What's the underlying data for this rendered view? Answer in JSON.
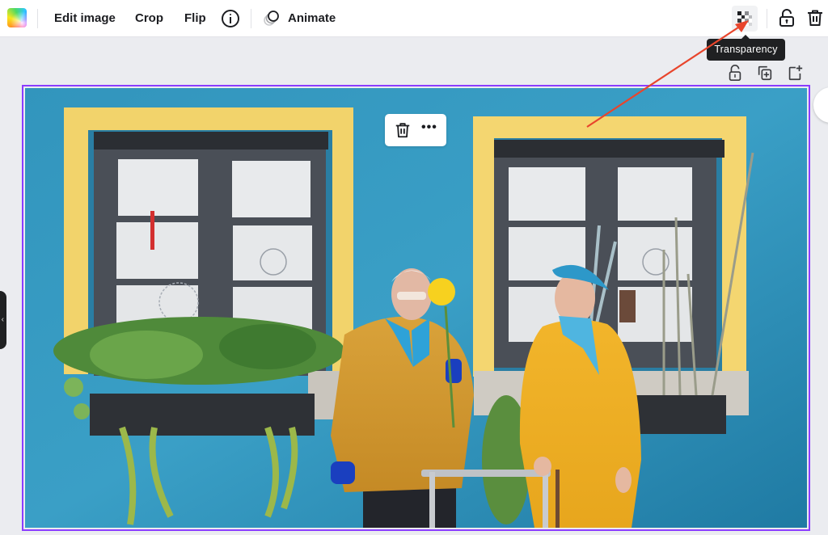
{
  "toolbar": {
    "edit_image_label": "Edit image",
    "crop_label": "Crop",
    "flip_label": "Flip",
    "animate_label": "Animate",
    "icons": {
      "color_swatch": "color-swatch-icon",
      "info": "info-icon",
      "animate": "animate-icon",
      "transparency": "transparency-icon",
      "lock": "lock-icon",
      "delete": "trash-icon"
    }
  },
  "tooltip": {
    "text": "Transparency"
  },
  "element_actions": {
    "icons": [
      "lock-icon",
      "duplicate-icon",
      "add-page-icon"
    ]
  },
  "floating_menu": {
    "icons": [
      "trash-icon",
      "more-icon"
    ],
    "more_label": "•••"
  },
  "side_handle": {
    "label": "‹"
  },
  "canvas": {
    "image_description": "Elderly couple in mustard yellow clothing standing in front of a blue wall with yellow-framed windows and flower boxes",
    "selection_color": "#8b3dff",
    "annotation_arrow_color": "#e8452c"
  }
}
